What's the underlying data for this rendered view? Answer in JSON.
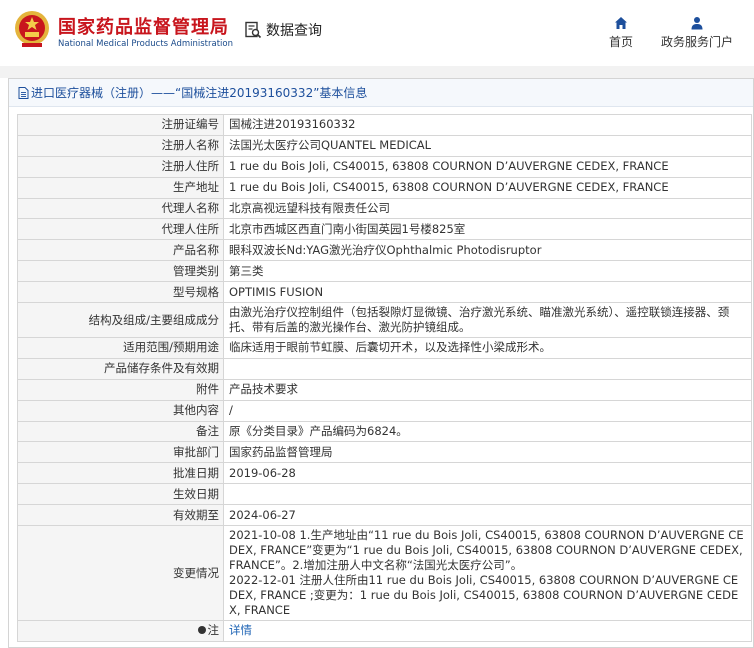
{
  "header": {
    "title": "国家药品监督管理局",
    "subtitle": "National Medical Products Administration",
    "query_label": "数据查询",
    "nav": [
      {
        "label": "首页",
        "icon": "home-icon"
      },
      {
        "label": "政务服务门户",
        "icon": "user-icon"
      }
    ]
  },
  "panel": {
    "title": "进口医疗器械（注册）——“国械注进20193160332”基本信息"
  },
  "colors": {
    "brand_red": "#c8151d",
    "link_blue": "#1d63b4",
    "label_bg": "#f5f5f5"
  },
  "rows": [
    {
      "label": "注册证编号",
      "value": "国械注进20193160332"
    },
    {
      "label": "注册人名称",
      "value": "法国光太医疗公司QUANTEL MEDICAL"
    },
    {
      "label": "注册人住所",
      "value": "1 rue du Bois Joli, CS40015, 63808 COURNON D’AUVERGNE CEDEX, FRANCE"
    },
    {
      "label": "生产地址",
      "value": "1 rue du Bois Joli, CS40015, 63808 COURNON D’AUVERGNE CEDEX, FRANCE"
    },
    {
      "label": "代理人名称",
      "value": "北京高视远望科技有限责任公司"
    },
    {
      "label": "代理人住所",
      "value": "北京市西城区西直门南小街国英园1号楼825室"
    },
    {
      "label": "产品名称",
      "value": "眼科双波长Nd:YAG激光治疗仪Ophthalmic Photodisruptor"
    },
    {
      "label": "管理类别",
      "value": "第三类"
    },
    {
      "label": "型号规格",
      "value": "OPTIMIS FUSION"
    },
    {
      "label": "结构及组成/主要组成成分",
      "value": "由激光治疗仪控制组件（包括裂隙灯显微镜、治疗激光系统、瞄准激光系统）、遥控联锁连接器、颈托、带有后盖的激光操作台、激光防护镜组成。"
    },
    {
      "label": "适用范围/预期用途",
      "value": "临床适用于眼前节虹膜、后囊切开术，以及选择性小梁成形术。"
    },
    {
      "label": "产品储存条件及有效期",
      "value": ""
    },
    {
      "label": "附件",
      "value": "产品技术要求"
    },
    {
      "label": "其他内容",
      "value": "/"
    },
    {
      "label": "备注",
      "value": "原《分类目录》产品编码为6824。"
    },
    {
      "label": "审批部门",
      "value": "国家药品监督管理局"
    },
    {
      "label": "批准日期",
      "value": "2019-06-28"
    },
    {
      "label": "生效日期",
      "value": ""
    },
    {
      "label": "有效期至",
      "value": "2024-06-27"
    },
    {
      "label": "变更情况",
      "value_lines": [
        "2021-10-08 1.生产地址由“11 rue du Bois Joli, CS40015, 63808 COURNON D’AUVERGNE CEDEX, FRANCE”变更为“1 rue du Bois Joli, CS40015, 63808 COURNON D’AUVERGNE CEDEX, FRANCE”。2.增加注册人中文名称“法国光太医疗公司”。",
        "2022-12-01 注册人住所由11 rue du Bois Joli, CS40015, 63808 COURNON D’AUVERGNE CEDEX, FRANCE ;变更为：1 rue du Bois Joli, CS40015, 63808 COURNON D’AUVERGNE CEDEX, FRANCE"
      ]
    },
    {
      "label": "注",
      "value": "详情",
      "icon": "info-icon"
    }
  ]
}
